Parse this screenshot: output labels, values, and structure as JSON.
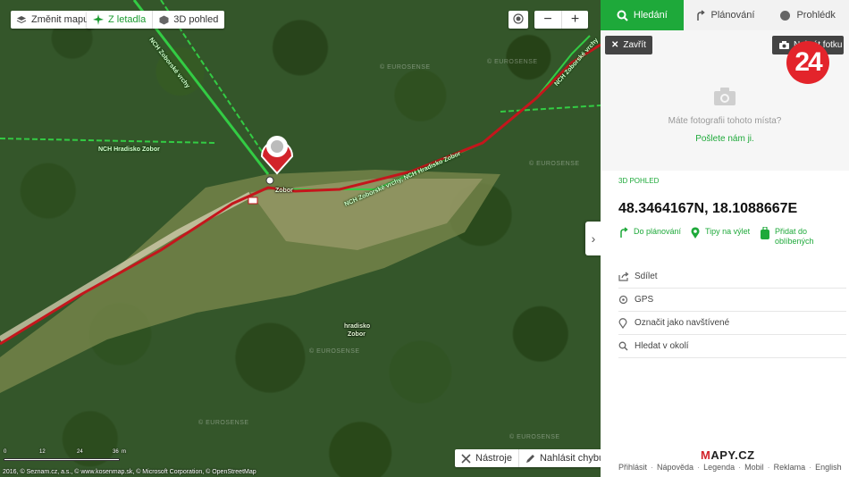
{
  "map_controls": {
    "change_map": "Změnit mapu",
    "aerial": "Z letadla",
    "view3d": "3D pohled",
    "zoom_out": "−",
    "zoom_in": "+",
    "tools": "Nástroje",
    "report_error": "Nahlásit chybu"
  },
  "map": {
    "poi_name": "Zobor",
    "place_label_1": "hradisko",
    "place_label_2": "Zobor",
    "trail_1": "NCH Zoborské vrchy",
    "trail_2": "NCH Hradisko Zobor",
    "trail_3": "NCH Zoborské vrchy, NCH Hradisko Zobor",
    "trail_4": "NCH Zoborské vrchy",
    "watermark": "© EUROSENSE",
    "scale_labels": [
      "0",
      "12",
      "24",
      "36"
    ],
    "scale_unit": "m",
    "attribution": "2016, © Seznam.cz, a.s., © www.kosenmap.sk, © Microsoft Corporation, © OpenStreetMap",
    "route_color": "#c4161c",
    "trail_color": "#33cc44"
  },
  "panel": {
    "tabs": [
      {
        "label": "Hledání",
        "icon": "search-icon"
      },
      {
        "label": "Plánování",
        "icon": "route-icon"
      },
      {
        "label": "Prohlédk",
        "icon": "globe-icon"
      }
    ],
    "close_label": "Zavřít",
    "add_photo_label": "Nahrát fotku",
    "photo_question": "Máte fotografii tohoto místa?",
    "photo_send": "Pošlete nám ji.",
    "logo_24": "24",
    "view3d_label": "3D POHLED",
    "coordinates": "48.3464167N, 18.1088667E",
    "actions": [
      {
        "label": "Do plánování",
        "icon": "route-arrow-icon"
      },
      {
        "label": "Tipy na výlet",
        "icon": "pin-icon"
      },
      {
        "label": "Přidat do",
        "label2": "oblíbených",
        "icon": "backpack-icon"
      }
    ],
    "menu": [
      {
        "label": "Sdílet",
        "icon": "share-icon"
      },
      {
        "label": "GPS",
        "icon": "gps-icon"
      },
      {
        "label": "Označit jako navštívené",
        "icon": "pin-outline-icon"
      },
      {
        "label": "Hledat v okolí",
        "icon": "search-icon"
      }
    ],
    "brand_first": "M",
    "brand_rest": "APY.CZ",
    "footer": [
      "Přihlásit",
      "Nápověda",
      "Legenda",
      "Mobil",
      "Reklama",
      "English"
    ],
    "accent_color": "#1ea93a"
  }
}
